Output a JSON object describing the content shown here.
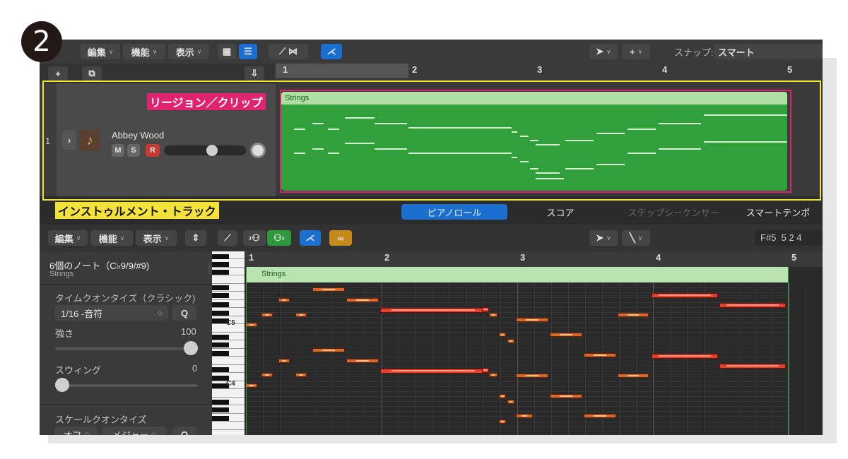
{
  "step_number": "2",
  "toolbar": {
    "edit": "編集",
    "function": "機能",
    "view": "表示",
    "snap_label": "スナップ:",
    "snap_value": "スマート"
  },
  "track": {
    "number": "1",
    "name": "Abbey Wood",
    "mute": "M",
    "solo": "S",
    "record": "R",
    "volume": 0.6
  },
  "region": {
    "name": "Strings"
  },
  "annotations": {
    "region_clip": "リージョン／クリップ",
    "instrument_track": "インストゥルメント・トラック"
  },
  "ruler": {
    "bars": [
      "1",
      "2",
      "3",
      "4",
      "5"
    ]
  },
  "editor_tabs": [
    "ピアノロール",
    "スコア",
    "ステップシーケンサー",
    "スマートテンポ"
  ],
  "editor_tab_active": 0,
  "editor_toolbar": {
    "edit": "編集",
    "function": "機能",
    "view": "表示",
    "position": "F#5  5 2 4"
  },
  "inspector": {
    "note_info": "6個のノート（C♭9/9/#9)",
    "note_track": "Strings",
    "time_quantize_label": "タイムクオンタイズ（クラシック)",
    "quantize_value": "1/16 -音符",
    "q_button": "Q",
    "strength_label": "強さ",
    "strength_value": "100",
    "strength_level": 1.0,
    "swing_label": "スウィング",
    "swing_value": "0",
    "swing_level": 0.0,
    "scale_quantize_label": "スケールクオンタイズ",
    "scale_off": "オフ",
    "scale_major": "メジャー",
    "scale_q": "Q"
  },
  "piano": {
    "c5": "C5",
    "c4": "C4"
  },
  "icons": [
    "plus-icon",
    "duplicate-icon",
    "catch-icon",
    "pointer-tool-icon",
    "marquee-icon",
    "midi-in-icon",
    "link-icon"
  ],
  "colors": {
    "region_green": "#31a03c",
    "annotation_pink": "#e0236f",
    "annotation_yellow": "#f2e23a",
    "tab_blue": "#1b6fd0",
    "note_red": "#e5402e"
  }
}
